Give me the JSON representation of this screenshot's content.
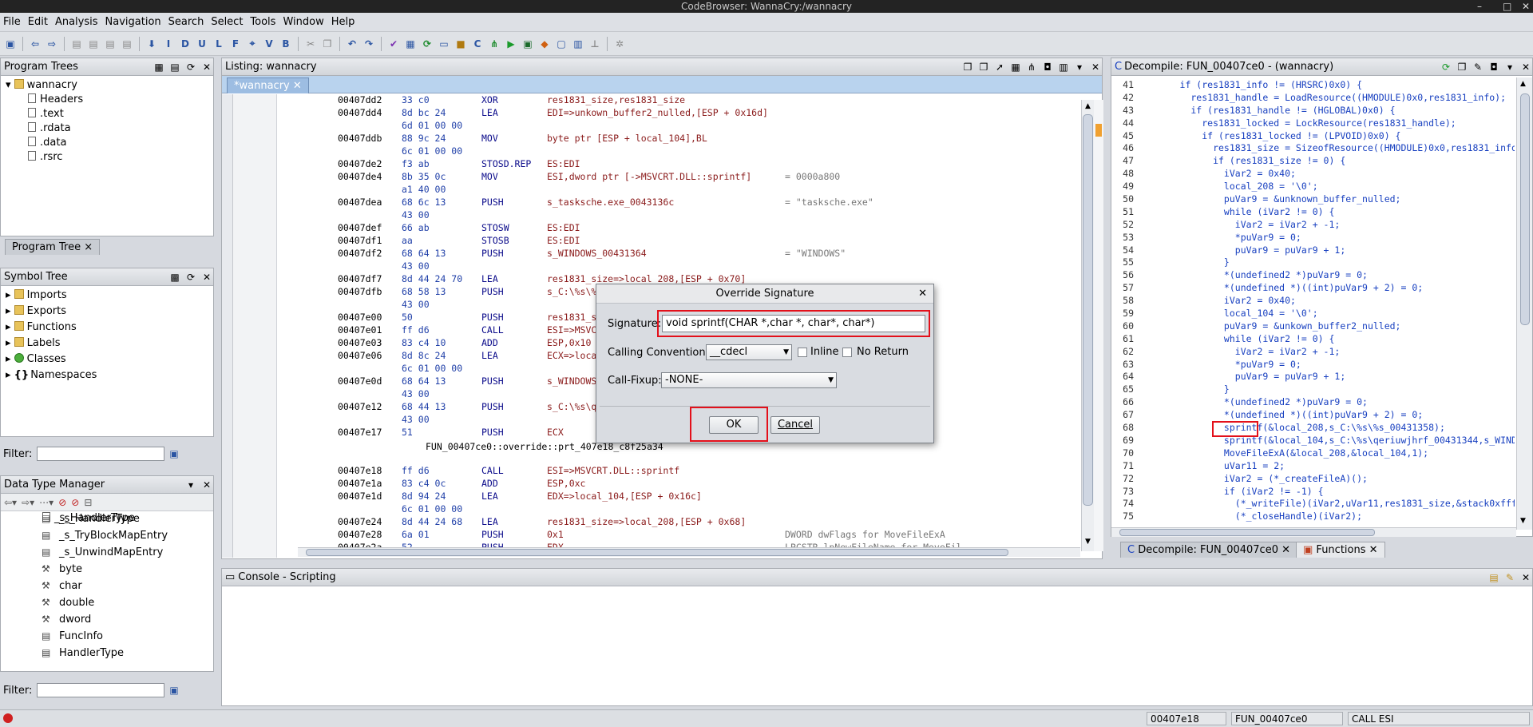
{
  "window": {
    "title": "CodeBrowser: WannaCry:/wannacry"
  },
  "menu": [
    "File",
    "Edit",
    "Analysis",
    "Navigation",
    "Search",
    "Select",
    "Tools",
    "Window",
    "Help"
  ],
  "program_trees": {
    "title": "Program Trees",
    "root": "wannacry",
    "items": [
      "Headers",
      ".text",
      ".rdata",
      ".data",
      ".rsrc"
    ],
    "tab": "Program Tree"
  },
  "symbol_tree": {
    "title": "Symbol Tree",
    "items": [
      "Imports",
      "Exports",
      "Functions",
      "Labels",
      "Classes",
      "Namespaces"
    ]
  },
  "filter_label": "Filter:",
  "data_type_manager": {
    "title": "Data Type Manager",
    "items": [
      "_s_HandlerType",
      "_s_TryBlockMapEntry",
      "_s_UnwindMapEntry",
      "byte",
      "char",
      "double",
      "dword",
      "FuncInfo",
      "HandlerType"
    ]
  },
  "listing": {
    "title": "Listing:  wannacry",
    "tab": "*wannacry",
    "rows": [
      [
        "00407dd2",
        "33 c0",
        "XOR",
        "res1831_size,res1831_size",
        ""
      ],
      [
        "00407dd4",
        "8d bc 24",
        "LEA",
        "EDI=>unkown_buffer2_nulled,[ESP + 0x16d]",
        ""
      ],
      [
        "",
        "6d 01 00 00",
        "",
        "",
        ""
      ],
      [
        "00407ddb",
        "88 9c 24",
        "MOV",
        "byte ptr [ESP + local_104],BL",
        ""
      ],
      [
        "",
        "6c 01 00 00",
        "",
        "",
        ""
      ],
      [
        "00407de2",
        "f3 ab",
        "STOSD.REP",
        "ES:EDI",
        ""
      ],
      [
        "00407de4",
        "8b 35 0c",
        "MOV",
        "ESI,dword ptr [->MSVCRT.DLL::sprintf]",
        "= 0000a800"
      ],
      [
        "",
        "a1 40 00",
        "",
        "",
        ""
      ],
      [
        "00407dea",
        "68 6c 13",
        "PUSH",
        "s_tasksche.exe_0043136c",
        "= \"tasksche.exe\""
      ],
      [
        "",
        "43 00",
        "",
        "",
        ""
      ],
      [
        "00407def",
        "66 ab",
        "STOSW",
        "ES:EDI",
        ""
      ],
      [
        "00407df1",
        "aa",
        "STOSB",
        "ES:EDI",
        ""
      ],
      [
        "00407df2",
        "68 64 13",
        "PUSH",
        "s_WINDOWS_00431364",
        "= \"WINDOWS\""
      ],
      [
        "",
        "43 00",
        "",
        "",
        ""
      ],
      [
        "00407df7",
        "8d 44 24 70",
        "LEA",
        "res1831_size=>local_208,[ESP + 0x70]",
        ""
      ],
      [
        "00407dfb",
        "68 58 13",
        "PUSH",
        "s_C:\\%s\\%s_00431358",
        "= \"C:\\%s\\%s\""
      ],
      [
        "",
        "43 00",
        "",
        "",
        ""
      ],
      [
        "00407e00",
        "50",
        "PUSH",
        "res1831_size",
        ""
      ],
      [
        "00407e01",
        "ff d6",
        "CALL",
        "ESI=>MSVCRT.DLL::sprintf",
        ""
      ],
      [
        "00407e03",
        "83 c4 10",
        "ADD",
        "ESP,0x10",
        ""
      ],
      [
        "00407e06",
        "8d 8c 24",
        "LEA",
        "ECX=>local_104,[ESP + 0x16c]",
        ""
      ],
      [
        "",
        "6c 01 00 00",
        "",
        "",
        ""
      ],
      [
        "00407e0d",
        "68 64 13",
        "PUSH",
        "s_WINDOWS_00431364",
        ""
      ],
      [
        "",
        "43 00",
        "",
        "",
        ""
      ],
      [
        "00407e12",
        "68 44 13",
        "PUSH",
        "s_C:\\%s\\qeriuwjhrf_00431344",
        ""
      ],
      [
        "",
        "43 00",
        "",
        "",
        ""
      ],
      [
        "00407e17",
        "51",
        "PUSH",
        "ECX",
        ""
      ],
      [
        "",
        "",
        "",
        "",
        ""
      ],
      [
        "",
        "",
        "",
        "",
        ""
      ],
      [
        "00407e18",
        "ff d6",
        "CALL",
        "ESI=>MSVCRT.DLL::sprintf",
        ""
      ],
      [
        "00407e1a",
        "83 c4 0c",
        "ADD",
        "ESP,0xc",
        ""
      ],
      [
        "00407e1d",
        "8d 94 24",
        "LEA",
        "EDX=>local_104,[ESP + 0x16c]",
        ""
      ],
      [
        "",
        "6c 01 00 00",
        "",
        "",
        ""
      ],
      [
        "00407e24",
        "8d 44 24 68",
        "LEA",
        "res1831_size=>local_208,[ESP + 0x68]",
        ""
      ],
      [
        "00407e28",
        "6a 01",
        "PUSH",
        "0x1",
        "DWORD dwFlags for MoveFileExA"
      ],
      [
        "00407e2a",
        "52",
        "PUSH",
        "EDX",
        "LPCSTR lpNewFileName for MoveFil"
      ]
    ],
    "override_label": "FUN_00407ce0::override::prt_407e18_c8f25a34"
  },
  "decompile": {
    "title": "Decompile: FUN_00407ce0 - (wannacry)",
    "tabs": [
      "Decompile: FUN_00407ce0",
      "Functions"
    ],
    "lines": [
      [
        "41",
        "      if (res1831_info != (HRSRC)0x0) {"
      ],
      [
        "42",
        "        res1831_handle = LoadResource((HMODULE)0x0,res1831_info);"
      ],
      [
        "43",
        "        if (res1831_handle != (HGLOBAL)0x0) {"
      ],
      [
        "44",
        "          res1831_locked = LockResource(res1831_handle);"
      ],
      [
        "45",
        "          if (res1831_locked != (LPVOID)0x0) {"
      ],
      [
        "46",
        "            res1831_size = SizeofResource((HMODULE)0x0,res1831_info);"
      ],
      [
        "47",
        "            if (res1831_size != 0) {"
      ],
      [
        "48",
        "              iVar2 = 0x40;"
      ],
      [
        "49",
        "              local_208 = '\\0';"
      ],
      [
        "50",
        "              puVar9 = &unknown_buffer_nulled;"
      ],
      [
        "51",
        "              while (iVar2 != 0) {"
      ],
      [
        "52",
        "                iVar2 = iVar2 + -1;"
      ],
      [
        "53",
        "                *puVar9 = 0;"
      ],
      [
        "54",
        "                puVar9 = puVar9 + 1;"
      ],
      [
        "55",
        "              }"
      ],
      [
        "56",
        "              *(undefined2 *)puVar9 = 0;"
      ],
      [
        "57",
        "              *(undefined *)((int)puVar9 + 2) = 0;"
      ],
      [
        "58",
        "              iVar2 = 0x40;"
      ],
      [
        "59",
        "              local_104 = '\\0';"
      ],
      [
        "60",
        "              puVar9 = &unkown_buffer2_nulled;"
      ],
      [
        "61",
        "              while (iVar2 != 0) {"
      ],
      [
        "62",
        "                iVar2 = iVar2 + -1;"
      ],
      [
        "63",
        "                *puVar9 = 0;"
      ],
      [
        "64",
        "                puVar9 = puVar9 + 1;"
      ],
      [
        "65",
        "              }"
      ],
      [
        "66",
        "              *(undefined2 *)puVar9 = 0;"
      ],
      [
        "67",
        "              *(undefined *)((int)puVar9 + 2) = 0;"
      ],
      [
        "68",
        "              sprintf(&local_208,s_C:\\%s\\%s_00431358);"
      ],
      [
        "69",
        "              sprintf(&local_104,s_C:\\%s\\qeriuwjhrf_00431344,s_WINDO"
      ],
      [
        "70",
        "              MoveFileExA(&local_208,&local_104,1);"
      ],
      [
        "71",
        "              uVar11 = 2;"
      ],
      [
        "72",
        "              iVar2 = (*_createFileA)();"
      ],
      [
        "73",
        "              if (iVar2 != -1) {"
      ],
      [
        "74",
        "                (*_writeFile)(iVar2,uVar11,res1831_size,&stack0xffff"
      ],
      [
        "75",
        "                (*_closeHandle)(iVar2);"
      ]
    ]
  },
  "console": {
    "title": "Console - Scripting"
  },
  "dialog": {
    "title": "Override Signature",
    "signature_label": "Signature:",
    "signature_value": "void sprintf(CHAR *,char *, char*, char*)",
    "calling_label": "Calling Convention:",
    "calling_value": "__cdecl",
    "inline_label": "Inline",
    "noreturn_label": "No Return",
    "fixup_label": "Call-Fixup:",
    "fixup_value": "-NONE-",
    "ok": "OK",
    "cancel": "Cancel"
  },
  "status": {
    "address": "00407e18",
    "function": "FUN_00407ce0",
    "instruction": "CALL ESI"
  }
}
